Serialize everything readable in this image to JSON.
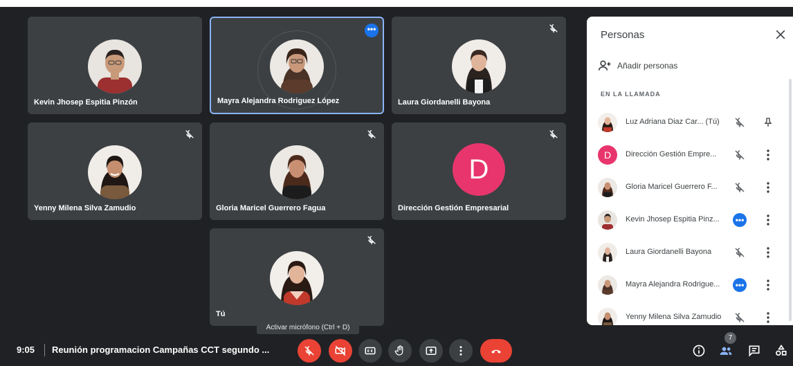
{
  "tiles": [
    {
      "name": "Kevin Jhosep Espitia Pinzón",
      "muted": false
    },
    {
      "name": "Mayra Alejandra Rodriguez López",
      "muted": false,
      "active": true
    },
    {
      "name": "Laura Giordanelli Bayona",
      "muted": true
    },
    {
      "name": "Yenny Milena Silva Zamudio",
      "muted": true
    },
    {
      "name": "Gloria Maricel Guerrero Fagua",
      "muted": true
    },
    {
      "name": "Dirección Gestión Empresarial",
      "muted": true,
      "letter": "D"
    },
    {
      "name": "Tú",
      "muted": true
    }
  ],
  "tooltip": "Activar micrófono (Ctrl + D)",
  "bottom": {
    "time": "9:05",
    "meeting_title": "Reunión programacion Campañas CCT segundo ...",
    "participants_count": "7"
  },
  "panel": {
    "title": "Personas",
    "add_people": "Añadir personas",
    "section": "EN LA LLAMADA",
    "people": [
      {
        "name": "Luz Adriana Diaz Car...  (Tú)",
        "status": "mic-off-icon",
        "action": "pin-icon"
      },
      {
        "name": "Dirección Gestión Empre...",
        "letter": "D",
        "status": "mic-off-icon",
        "action": "more-vert-icon"
      },
      {
        "name": "Gloria Maricel Guerrero F...",
        "status": "mic-off-icon",
        "action": "more-vert-icon"
      },
      {
        "name": "Kevin Jhosep Espitia Pinz...",
        "status": "speaking-icon",
        "action": "more-vert-icon"
      },
      {
        "name": "Laura Giordanelli Bayona",
        "status": "mic-off-icon",
        "action": "more-vert-icon"
      },
      {
        "name": "Mayra Alejandra Rodrigue...",
        "status": "speaking-icon",
        "action": "more-vert-icon"
      },
      {
        "name": "Yenny Milena Silva Zamudio",
        "status": "mic-off-icon",
        "action": "more-vert-icon"
      }
    ]
  },
  "colors": {
    "background": "#202124",
    "tile": "#3c4043",
    "accent": "#1a73e8",
    "danger": "#ea4335",
    "letter_avatar": "#e8356d",
    "active_border": "#8ab4f8"
  }
}
